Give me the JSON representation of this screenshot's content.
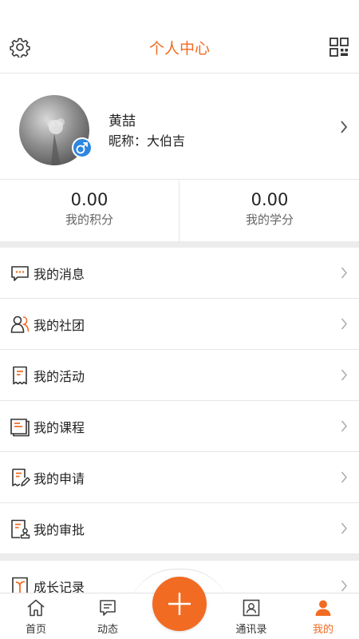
{
  "header": {
    "title": "个人中心",
    "left_icon": "gear-icon",
    "right_icon": "qr-code-icon"
  },
  "profile": {
    "name": "黄喆",
    "nickname": "昵称：大伯吉",
    "gender_symbol": "♂"
  },
  "stats": [
    {
      "value": "0.00",
      "label": "我的积分"
    },
    {
      "value": "0.00",
      "label": "我的学分"
    }
  ],
  "menu": [
    {
      "label": "我的消息",
      "icon": "message-icon"
    },
    {
      "label": "我的社团",
      "icon": "group-icon"
    },
    {
      "label": "我的活动",
      "icon": "activity-icon"
    },
    {
      "label": "我的课程",
      "icon": "course-icon"
    },
    {
      "label": "我的申请",
      "icon": "application-icon"
    },
    {
      "label": "我的审批",
      "icon": "approval-icon"
    }
  ],
  "menu2": [
    {
      "label": "成长记录",
      "icon": "growth-record-icon"
    }
  ],
  "tabbar": {
    "tabs": [
      {
        "label": "首页",
        "icon": "home-icon"
      },
      {
        "label": "动态",
        "icon": "feed-icon"
      },
      {
        "label": "通讯录",
        "icon": "contacts-icon"
      },
      {
        "label": "我的",
        "icon": "user-icon"
      }
    ],
    "active": "我的",
    "center_icon": "plus-icon"
  },
  "colors": {
    "accent": "#f26b22",
    "gender_badge": "#2d86e0",
    "divider": "#e6e6e6",
    "section_gap": "#ececec"
  }
}
